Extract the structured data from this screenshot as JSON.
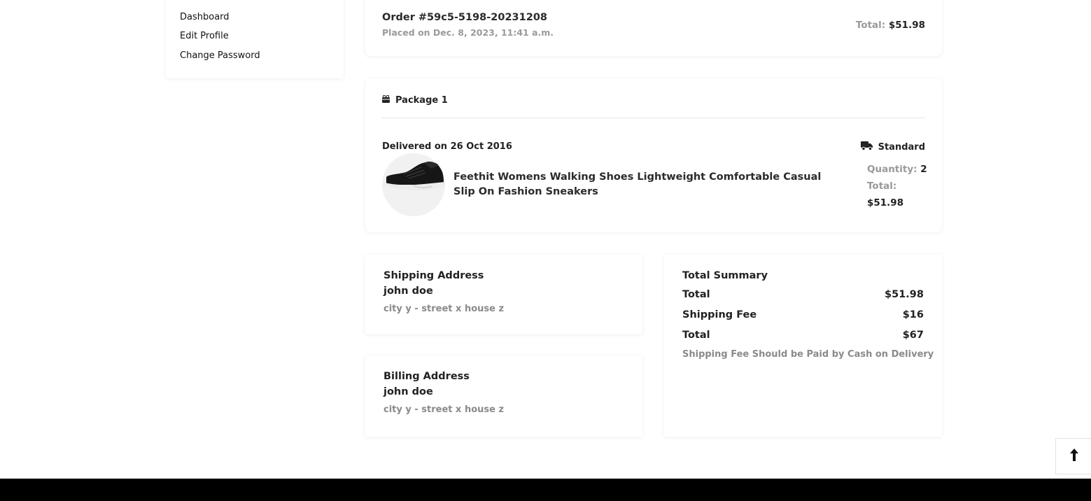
{
  "sidebar": {
    "items": [
      {
        "label": "Dashboard"
      },
      {
        "label": "Edit Profile"
      },
      {
        "label": "Change Password"
      }
    ]
  },
  "order": {
    "id_text": "Order #59c5-5198-20231208",
    "placed_text": "Placed on Dec. 8, 2023, 11:41 a.m.",
    "total_label": "Total:",
    "total_value": "$51.98"
  },
  "package": {
    "title": "Package 1",
    "delivered_text": "Delivered on 26 Oct 2016",
    "shipping_method": "Standard",
    "product": {
      "name": "Feethit Womens Walking Shoes Lightweight Comfortable Casual Slip On Fashion Sneakers",
      "quantity_label": "Quantity:",
      "quantity_value": "2",
      "total_label": "Total:",
      "total_value": "$51.98"
    }
  },
  "shipping_address": {
    "title": "Shipping Address",
    "name": "john doe",
    "line": "city y - street x house z"
  },
  "billing_address": {
    "title": "Billing Address",
    "name": "john doe",
    "line": "city y - street x house z"
  },
  "summary": {
    "title": "Total Summary",
    "rows": [
      {
        "label": "Total",
        "value": "$51.98"
      },
      {
        "label": "Shipping Fee",
        "value": "$16"
      },
      {
        "label": "Total",
        "value": "$67"
      }
    ],
    "note": "Shipping Fee Should be Paid by Cash on Delivery"
  },
  "icons": {
    "package": "gift-box-icon",
    "shipping": "truck-icon",
    "scroll_top": "arrow-up-icon"
  },
  "colors": {
    "footer": "#000000",
    "muted_text": "#999999"
  }
}
